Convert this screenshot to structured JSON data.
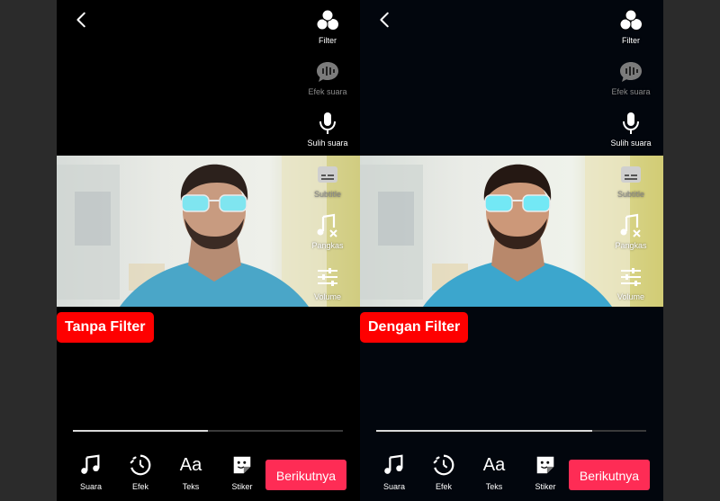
{
  "panels": [
    {
      "tag": "Tanpa Filter",
      "side_tools": [
        "Filter",
        "Efek suara",
        "Sulih suara",
        "Subtitle",
        "Pangkas",
        "Volume"
      ],
      "bottom_tools": [
        "Suara",
        "Efek",
        "Teks",
        "Stiker"
      ],
      "text_tool_glyph": "Aa",
      "next_button": "Berikutnya",
      "progress": 0.5
    },
    {
      "tag": "Dengan Filter",
      "side_tools": [
        "Filter",
        "Efek suara",
        "Sulih suara",
        "Subtitle",
        "Pangkas",
        "Volume"
      ],
      "bottom_tools": [
        "Suara",
        "Efek",
        "Teks",
        "Stiker"
      ],
      "text_tool_glyph": "Aa",
      "next_button": "Berikutnya",
      "progress": 0.8
    }
  ],
  "colors": {
    "tag_bg": "#fe0000",
    "next_button_bg": "#fe2c55",
    "accent_text": "#ffffff"
  },
  "icons": {
    "back": "chevron-left-icon",
    "filter": "filter-icon",
    "sound_effect": "speech-bubble-waveform-icon",
    "voiceover": "microphone-icon",
    "subtitle": "subtitle-icon",
    "trim": "music-note-cut-icon",
    "volume": "sliders-icon",
    "sound": "music-note-icon",
    "effects": "effect-timer-icon",
    "text": "text-aa-icon",
    "sticker": "sticker-icon"
  }
}
